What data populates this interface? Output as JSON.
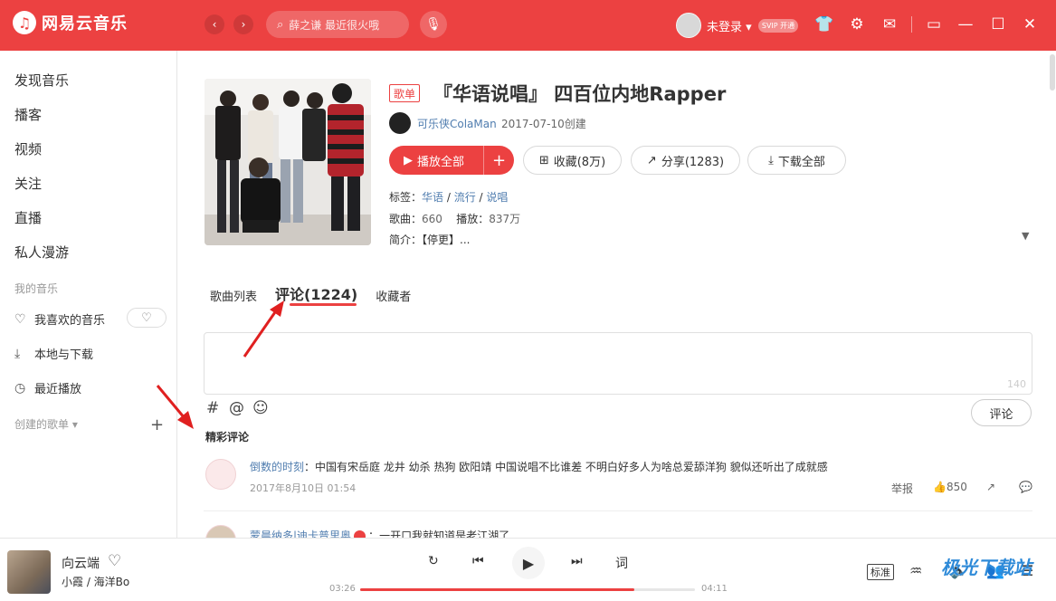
{
  "app": {
    "name": "网易云音乐",
    "logo_glyph": "♫",
    "accent": "#ec4141"
  },
  "topbar": {
    "back": "‹",
    "forward": "›",
    "search_placeholder": "薛之谦 最近很火哦",
    "mic": "🎙",
    "login": "未登录 ▾",
    "vip": "SVIP 开通",
    "icons": {
      "skin": "👕",
      "settings": "⚙",
      "mail": "✉",
      "mini": "▭",
      "minimize": "—",
      "maximize": "☐",
      "close": "✕"
    }
  },
  "sidebar": {
    "items": [
      "发现音乐",
      "播客",
      "视频",
      "关注",
      "直播",
      "私人漫游"
    ],
    "my_music_label": "我的音乐",
    "my_music": [
      {
        "label": "我喜欢的音乐",
        "icon": "♡"
      },
      {
        "label": "本地与下载",
        "icon": "⤓"
      },
      {
        "label": "最近播放",
        "icon": "◷"
      }
    ],
    "heart_mode_icon": "♡",
    "created_label": "创建的歌单 ▾",
    "add": "+"
  },
  "playlist": {
    "tag": "歌单",
    "title": "『华语说唱』 四百位内地Rapper",
    "creator": "可乐侠ColaMan",
    "created": "2017-07-10创建",
    "buttons": {
      "play_all": "播放全部",
      "add": "+",
      "collect": "收藏(8万)",
      "share": "分享(1283)",
      "download": "下载全部"
    },
    "tags_label": "标签：",
    "tags": [
      "华语",
      "流行",
      "说唱"
    ],
    "songs_label": "歌曲：",
    "songs": "660",
    "plays_label": "播放：",
    "plays": "837万",
    "intro_label": "简介：",
    "intro": "【停更】...",
    "expand": "▼"
  },
  "tabs": {
    "songs": "歌曲列表",
    "comments": "评论(1224)",
    "collectors": "收藏者"
  },
  "comment_box": {
    "counter": "140",
    "submit": "评论",
    "tools": {
      "topic": "#",
      "mention": "@",
      "emoji": "☺"
    }
  },
  "comments_section": "精彩评论",
  "comments": [
    {
      "user": "倒数的时刻",
      "text": "中国有宋岳庭 龙井 幼杀 热狗 欧阳靖 中国说唱不比谁差 不明白好多人为啥总爱舔洋狗 貌似还听出了成就感",
      "time": "2017年8月10日 01:54",
      "report": "举报",
      "likes": "850"
    },
    {
      "user": "蒙晨纳多|迪卡普里奥",
      "text": "一开口我就知道是老江湖了"
    }
  ],
  "player": {
    "title": "向云端",
    "artist": "小霞 / 海洋Bo",
    "elapsed": "03:26",
    "total": "04:11",
    "progress": 0.82,
    "lyrics": "词",
    "quality": "标准",
    "controls": {
      "mode": "↻",
      "prev": "⏮",
      "play": "▶",
      "next": "⏭"
    },
    "watermark": "极光下载站"
  }
}
